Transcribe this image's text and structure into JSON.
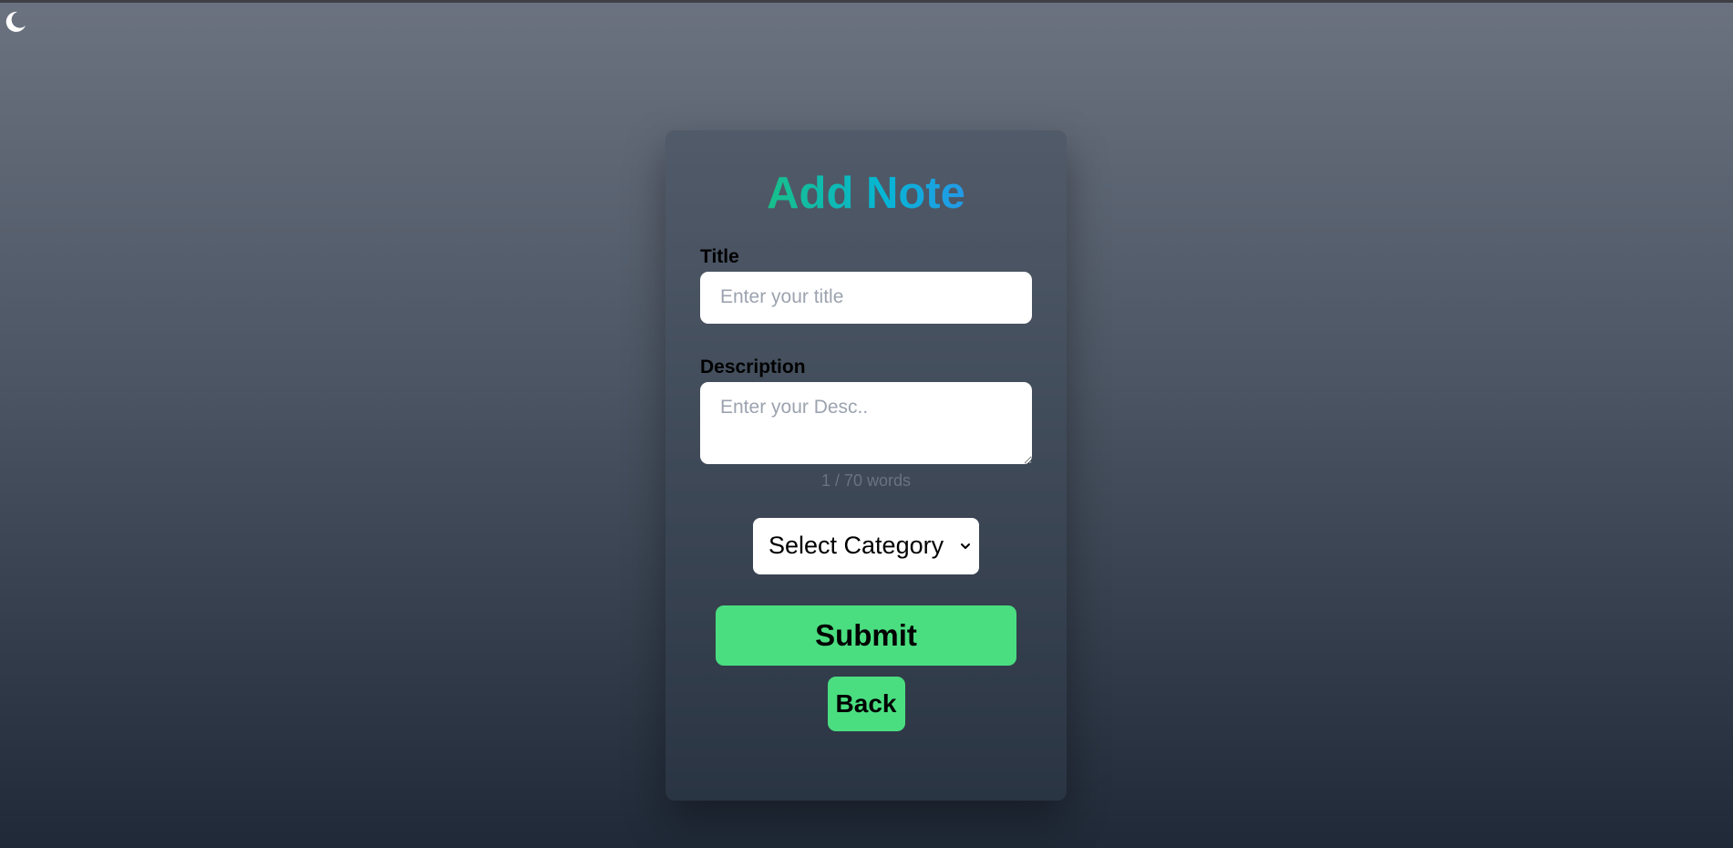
{
  "theme_toggle": {
    "icon": "moon-icon"
  },
  "form": {
    "heading": "Add Note",
    "title_label": "Title",
    "title_placeholder": "Enter your title",
    "title_value": "",
    "description_label": "Description",
    "description_placeholder": "Enter your Desc..",
    "description_value": "",
    "word_count": "1 / 70 words",
    "category_selected": "Select Category",
    "submit_label": "Submit",
    "back_label": "Back"
  },
  "colors": {
    "accent_green": "#4ade80",
    "heading_gradient_start": "#22c55e",
    "heading_gradient_mid": "#06b6d4",
    "heading_gradient_end": "#3b82f6"
  }
}
